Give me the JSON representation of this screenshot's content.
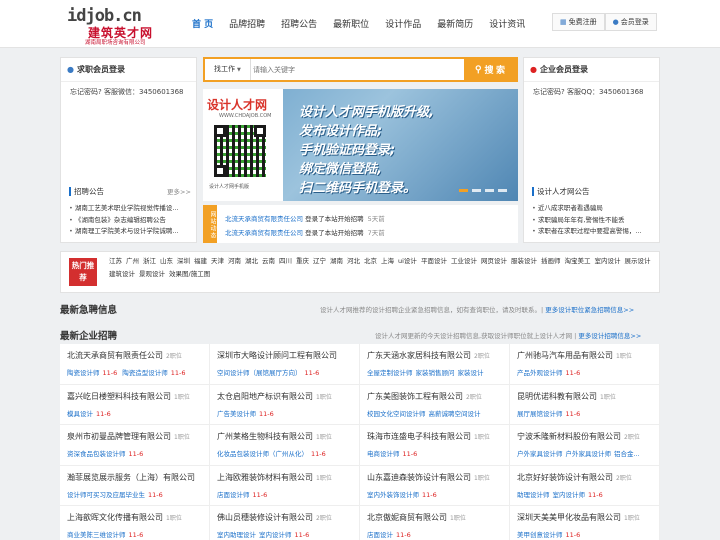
{
  "logo": {
    "main": "idjob.cn",
    "cn": "建筑英才网",
    "sub": "湖南局职场咨询有限公司"
  },
  "nav": [
    "首 页",
    "品牌招聘",
    "招聘公告",
    "最新职位",
    "设计作品",
    "最新简历",
    "设计资讯"
  ],
  "top_buttons": {
    "register": "免费注册",
    "login": "会员登录"
  },
  "left_panel": {
    "title": "求职会员登录",
    "line": "忘记密码?    客服微信：3450601368",
    "section": "招聘公告",
    "more": "更多>>",
    "items": [
      "湖南工艺美术职业学院视觉传播设...",
      "《湖南包装》杂志编辑招聘公告",
      "湖南理工学院美术与设计学院诚聘..."
    ]
  },
  "search": {
    "type": "找工作",
    "placeholder": "请输入关键字",
    "button": "搜 索"
  },
  "banner": {
    "brand": "设计人才网",
    "site": "WWW.CHDAJOB.COM",
    "qr_caption": "设计人才网手机版",
    "lines": [
      "设计人才网手机版升级,",
      "发布设计作品;",
      "手机验证码登录;",
      "绑定微信登陆,",
      "扫二维码手机登录。"
    ]
  },
  "news": {
    "tag": "网站动态",
    "rows": [
      {
        "company": "北流天承商贸有限责任公司",
        "action": "登录了本站开始招聘",
        "time": "5天前"
      },
      {
        "company": "北流天承商贸有限责任公司",
        "action": "登录了本站开始招聘",
        "time": "7天前"
      }
    ]
  },
  "right_panel": {
    "title": "企业会员登录",
    "line": "忘记密码?    客服QQ：3450601368",
    "section": "设计人才网公告",
    "items": [
      "近八成求职者看遇骗局",
      "求职骗局年年有,警惕性不能丢",
      "求职者在求职过程中要提高警惕，..."
    ]
  },
  "hot": {
    "label": "热门推荐",
    "tags": [
      "江苏",
      "广州",
      "浙江",
      "山东",
      "深圳",
      "福建",
      "天津",
      "河南",
      "湖北",
      "云南",
      "四川",
      "重庆",
      "辽宁",
      "湖南",
      "河北",
      "北京",
      "上海",
      "ui设计",
      "平面设计",
      "工业设计",
      "网页设计",
      "服装设计",
      "插画师",
      "淘宝美工",
      "室内设计",
      "展示设计",
      "建筑设计",
      "景观设计",
      "效果图/施工图"
    ]
  },
  "urgent": {
    "title": "最新急聘信息",
    "desc": "设计人才网推荐的设计招聘企业紧急招聘信息，如有查询职位，请及时联系。|",
    "link": "更多设计职位紧急招聘信息>>"
  },
  "latest": {
    "title": "最新企业招聘",
    "desc": "设计人才网更新的今天设计招聘信息,获取设计师职位就上设计人才网 |",
    "link": "更多设计招聘信息>>"
  },
  "companies": [
    {
      "name": "北流天承商贸有限责任公司",
      "count": "2职位",
      "jobs": [
        {
          "t": "陶瓷设计师",
          "d": "11-6"
        },
        {
          "t": "陶瓷造型设计师",
          "d": "11-6"
        }
      ]
    },
    {
      "name": "深圳市大略设计顾问工程有限公司",
      "count": "",
      "jobs": [
        {
          "t": "空间设计师（展馆展厅方向）",
          "d": "11-6"
        }
      ]
    },
    {
      "name": "广东天涵水家居科技有限公司",
      "count": "2职位",
      "jobs": [
        {
          "t": "全屋定制设计师",
          "d": ""
        },
        {
          "t": "家装销售顾问",
          "d": ""
        },
        {
          "t": "家装设计",
          "d": ""
        }
      ]
    },
    {
      "name": "广州驰马汽车用品有限公司",
      "count": "1职位",
      "jobs": [
        {
          "t": "产品外观设计师",
          "d": "11-6"
        }
      ]
    },
    {
      "name": "嘉兴屹日楼塑料科技有限公司",
      "count": "1职位",
      "jobs": [
        {
          "t": "模具设计",
          "d": "11-6"
        }
      ]
    },
    {
      "name": "太仓启阳地产标识有限公司",
      "count": "1职位",
      "jobs": [
        {
          "t": "广告美设计师",
          "d": "11-6"
        }
      ]
    },
    {
      "name": "广东美图装饰工程有限公司",
      "count": "2职位",
      "jobs": [
        {
          "t": "校园文化空间设计师",
          "d": ""
        },
        {
          "t": "高薪诚聘空间设计",
          "d": ""
        }
      ]
    },
    {
      "name": "昆明优诺科教有限公司",
      "count": "1职位",
      "jobs": [
        {
          "t": "展厅展馆设计师",
          "d": "11-6"
        }
      ]
    },
    {
      "name": "泉州市初曼品牌管理有限公司",
      "count": "1职位",
      "jobs": [
        {
          "t": "资深食品包装设计师",
          "d": "11-6"
        }
      ]
    },
    {
      "name": "广州莱格生物科技有限公司",
      "count": "1职位",
      "jobs": [
        {
          "t": "化妆品包装设计师（广州从化）",
          "d": "11-6"
        }
      ]
    },
    {
      "name": "珠海市连盛电子科技有限公司",
      "count": "1职位",
      "jobs": [
        {
          "t": "电商设计师",
          "d": "11-6"
        }
      ]
    },
    {
      "name": "宁波禾隆新材料股份有限公司",
      "count": "2职位",
      "jobs": [
        {
          "t": "户外家具设计师",
          "d": ""
        },
        {
          "t": "户外家具设计师",
          "d": ""
        },
        {
          "t": "铝合金...",
          "d": ""
        }
      ]
    },
    {
      "name": "瀚菲展览展示服务（上海）有限公司",
      "count": "",
      "jobs": [
        {
          "t": "设计师可买习及应届毕业生",
          "d": "11-6"
        }
      ]
    },
    {
      "name": "上海欧雅装饰材料有限公司",
      "count": "1职位",
      "jobs": [
        {
          "t": "店面设计师",
          "d": "11-6"
        }
      ]
    },
    {
      "name": "山东嘉迪森装饰设计有限公司",
      "count": "1职位",
      "jobs": [
        {
          "t": "室内外装饰设计师",
          "d": "11-6"
        }
      ]
    },
    {
      "name": "北京好好装饰设计有限公司",
      "count": "2职位",
      "jobs": [
        {
          "t": "助理设计师",
          "d": ""
        },
        {
          "t": "室内设计师",
          "d": "11-6"
        }
      ]
    },
    {
      "name": "上海歆晖文化传播有限公司",
      "count": "1职位",
      "jobs": [
        {
          "t": "商业美陈三维设计师",
          "d": "11-6"
        }
      ]
    },
    {
      "name": "佛山员穗装修设计有限公司",
      "count": "2职位",
      "jobs": [
        {
          "t": "室内助理设计",
          "d": ""
        },
        {
          "t": "室内设计师",
          "d": "11-6"
        }
      ]
    },
    {
      "name": "北京傲妮商贸有限公司",
      "count": "1职位",
      "jobs": [
        {
          "t": "店面设计",
          "d": "11-6"
        }
      ]
    },
    {
      "name": "深圳天美美甲化妆品有限公司",
      "count": "1职位",
      "jobs": [
        {
          "t": "美甲创意设计师",
          "d": "11-6"
        }
      ]
    }
  ],
  "colors": {
    "accent": "#1a6fc9",
    "orange": "#f2a024",
    "red": "#d32f2f"
  }
}
